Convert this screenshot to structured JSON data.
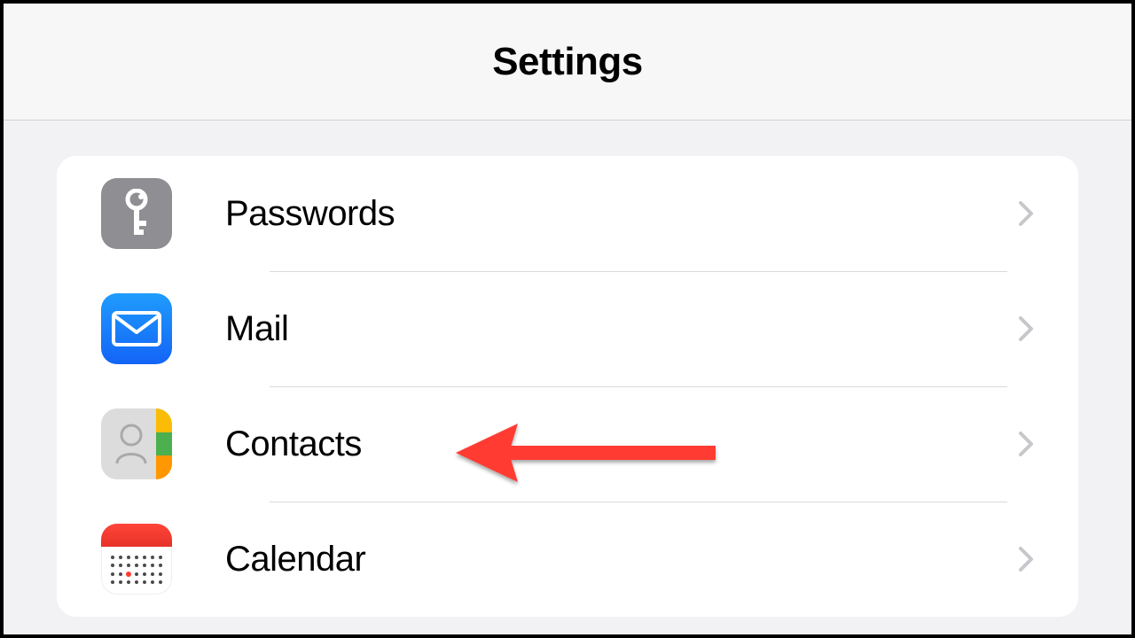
{
  "header": {
    "title": "Settings"
  },
  "items": [
    {
      "label": "Passwords",
      "icon": "passwords"
    },
    {
      "label": "Mail",
      "icon": "mail"
    },
    {
      "label": "Contacts",
      "icon": "contacts"
    },
    {
      "label": "Calendar",
      "icon": "calendar"
    }
  ],
  "annotation": {
    "target": "contacts",
    "color": "#ff3b30"
  }
}
